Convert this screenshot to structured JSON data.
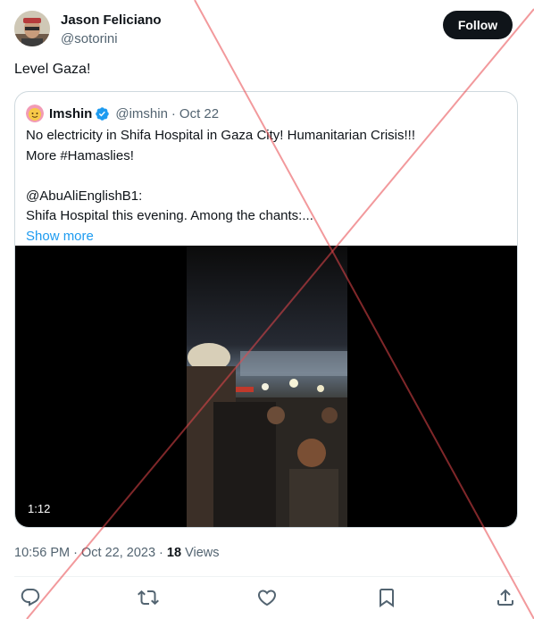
{
  "tweet": {
    "author_name": "Jason Feliciano",
    "author_handle": "@sotorini",
    "follow_label": "Follow",
    "text": "Level Gaza!",
    "time": "10:56 PM",
    "date": "Oct 22, 2023",
    "views_count": "18",
    "views_label": "Views"
  },
  "quoted": {
    "name": "Imshin",
    "handle": "@imshin",
    "sep": "·",
    "date": "Oct 22",
    "lines": [
      "No electricity in Shifa Hospital in Gaza City! Humanitarian Crisis!!!",
      "More #Hamaslies!",
      "",
      "@AbuAliEnglishB1:",
      "Shifa Hospital this evening. Among the chants:..."
    ],
    "show_more": "Show more",
    "video_duration": "1:12"
  },
  "colors": {
    "accent": "#1d9bf0",
    "text": "#0f1419",
    "muted": "#536471",
    "watermark": "#e8474c"
  },
  "icons": [
    "reply-icon",
    "retweet-icon",
    "like-icon",
    "bookmark-icon",
    "share-icon",
    "verified-icon"
  ]
}
